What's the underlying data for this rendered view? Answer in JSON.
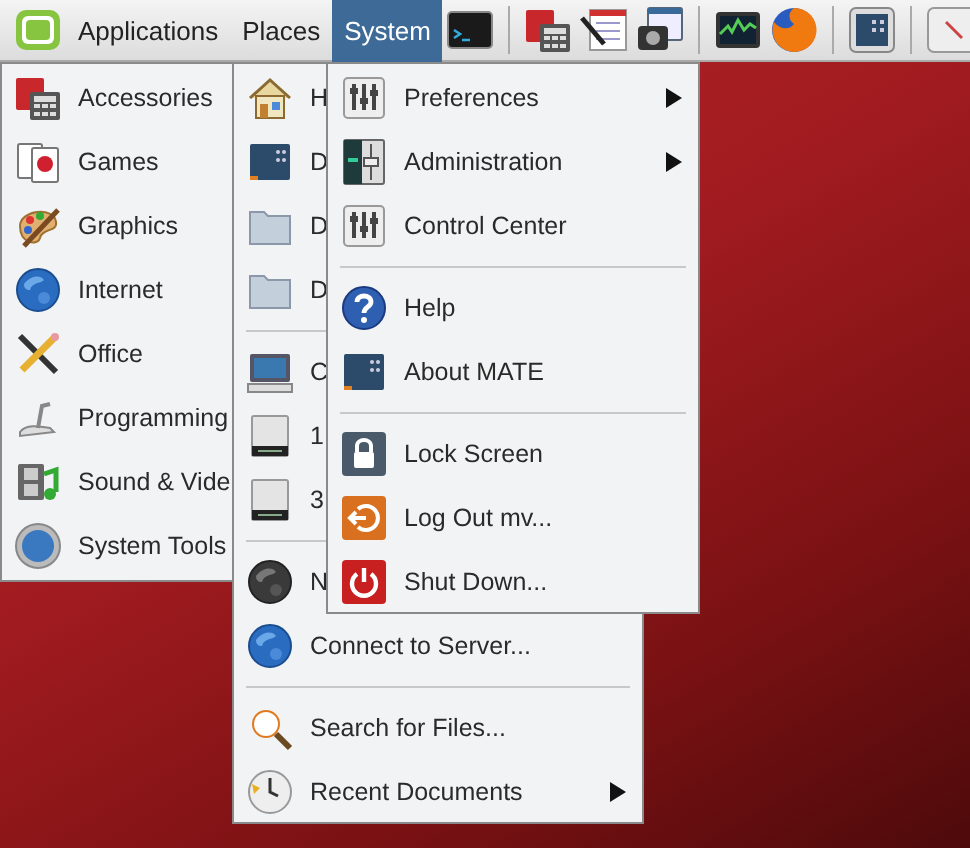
{
  "panel": {
    "menus": [
      {
        "label": "Applications",
        "selected": false
      },
      {
        "label": "Places",
        "selected": false
      },
      {
        "label": "System",
        "selected": true
      }
    ]
  },
  "applications_menu": {
    "items": [
      {
        "label": "Accessories"
      },
      {
        "label": "Games"
      },
      {
        "label": "Graphics"
      },
      {
        "label": "Internet"
      },
      {
        "label": "Office"
      },
      {
        "label": "Programming"
      },
      {
        "label": "Sound & Vide"
      },
      {
        "label": "System Tools"
      }
    ]
  },
  "places_menu": {
    "items": [
      {
        "kind": "item",
        "label": "H",
        "submenu": false
      },
      {
        "kind": "item",
        "label": "D",
        "submenu": false
      },
      {
        "kind": "item",
        "label": "D",
        "submenu": false
      },
      {
        "kind": "item",
        "label": "D",
        "submenu": false
      },
      {
        "kind": "separator"
      },
      {
        "kind": "item",
        "label": "C",
        "submenu": false
      },
      {
        "kind": "item",
        "label": "1",
        "submenu": false
      },
      {
        "kind": "item",
        "label": "3",
        "submenu": false
      },
      {
        "kind": "separator"
      },
      {
        "kind": "item",
        "label": "N",
        "submenu": false
      },
      {
        "kind": "item",
        "label": "Connect to Server...",
        "submenu": false
      },
      {
        "kind": "separator"
      },
      {
        "kind": "item",
        "label": "Search for Files...",
        "submenu": false
      },
      {
        "kind": "item",
        "label": "Recent Documents",
        "submenu": true
      }
    ]
  },
  "system_menu": {
    "items": [
      {
        "kind": "item",
        "label": "Preferences",
        "submenu": true
      },
      {
        "kind": "item",
        "label": "Administration",
        "submenu": true
      },
      {
        "kind": "item",
        "label": "Control Center",
        "submenu": false
      },
      {
        "kind": "separator"
      },
      {
        "kind": "item",
        "label": "Help",
        "submenu": false
      },
      {
        "kind": "item",
        "label": "About MATE",
        "submenu": false
      },
      {
        "kind": "separator"
      },
      {
        "kind": "item",
        "label": "Lock Screen",
        "submenu": false
      },
      {
        "kind": "item",
        "label": "Log Out mv...",
        "submenu": false
      },
      {
        "kind": "item",
        "label": "Shut Down...",
        "submenu": false
      }
    ]
  }
}
